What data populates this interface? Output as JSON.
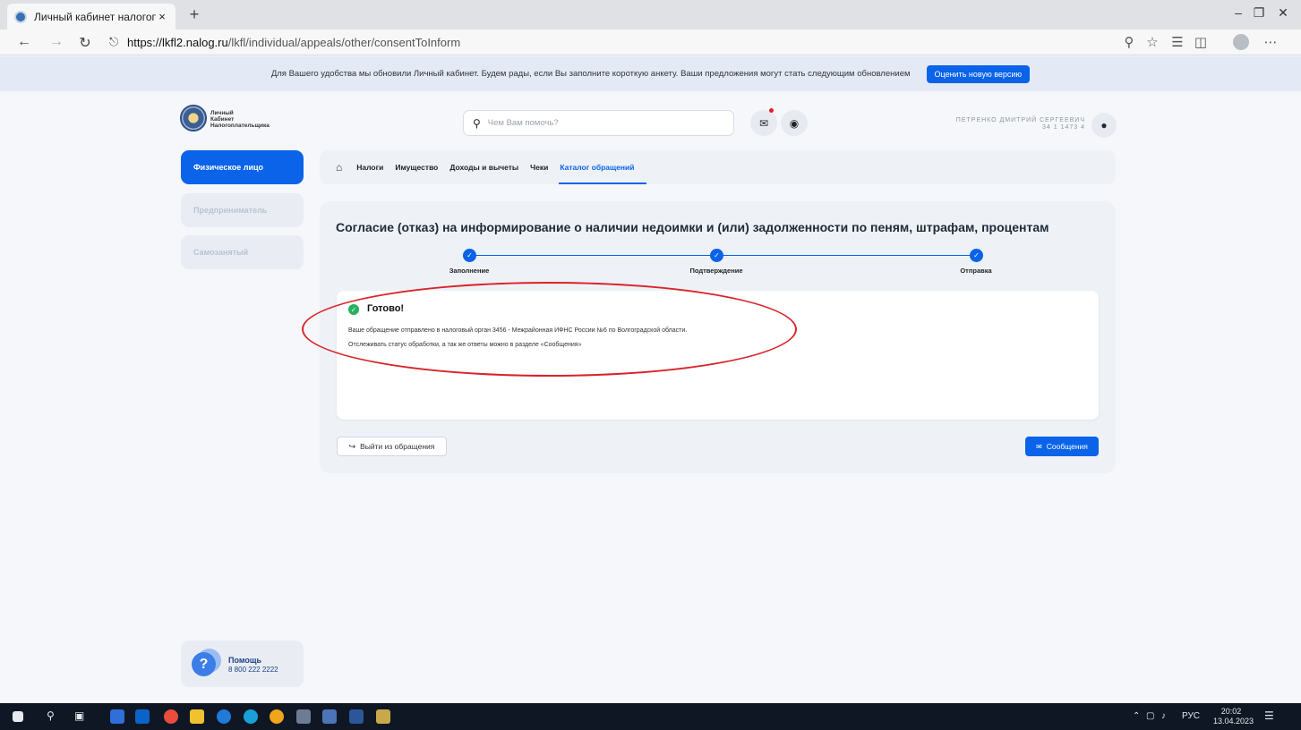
{
  "browser": {
    "tab_title": "Личный кабинет налогоплательщ",
    "tab_close": "×",
    "new_tab": "+",
    "url_host": "https://lkfl2.nalog.ru",
    "url_path": "/lkfl/individual/appeals/other/consentToInform",
    "back": "←",
    "forward": "→",
    "refresh": "↻",
    "lock": "🔒",
    "minimize": "–",
    "maximize": "❐",
    "close": "✕"
  },
  "banner": {
    "text": "Для Вашего удобства мы обновили Личный кабинет. Будем рады, если Вы заполните короткую анкету. Ваши предложения могут стать следующим обновлением",
    "button": "Оценить новую версию"
  },
  "header": {
    "logo_line1": "Личный",
    "logo_line2": "Кабинет",
    "logo_line3": "Налогоплательщика",
    "search_placeholder": "Чем Вам помочь?",
    "user_name": "ПЕТРЕНКО ДМИТРИЙ СЕРГЕЕВИЧ",
    "user_inn": "34 1 1473 4"
  },
  "sidebar": {
    "items": [
      {
        "label": "Физическое лицо"
      },
      {
        "label": "Предприниматель"
      },
      {
        "label": "Самозанятый"
      }
    ],
    "help_title": "Помощь",
    "help_phone": "8 800 222 2222"
  },
  "topnav": {
    "items": [
      "Налоги",
      "Имущество",
      "Доходы и вычеты",
      "Чеки",
      "Каталог обращений"
    ]
  },
  "main": {
    "title": "Согласие (отказ) на информирование о наличии недоимки и (или) задолженности по пеням, штрафам, процентам",
    "steps": [
      "Заполнение",
      "Подтверждение",
      "Отправка"
    ],
    "result_title": "Готово!",
    "result_line1": "Ваше обращение отправлено в налоговый орган 3456 - Межрайонная ИФНС России №6 по Волгоградской области.",
    "result_line2": "Отслеживать статус обработки, а так же ответы можно в разделе «Сообщения»",
    "exit_button": "Выйти из обращения",
    "messages_button": "Сообщения"
  },
  "taskbar": {
    "lang": "РУС",
    "time": "20:02",
    "date": "13.04.2023"
  },
  "colors": {
    "accent": "#0a63e9",
    "success": "#27b05f",
    "annotation": "#d9232a"
  }
}
